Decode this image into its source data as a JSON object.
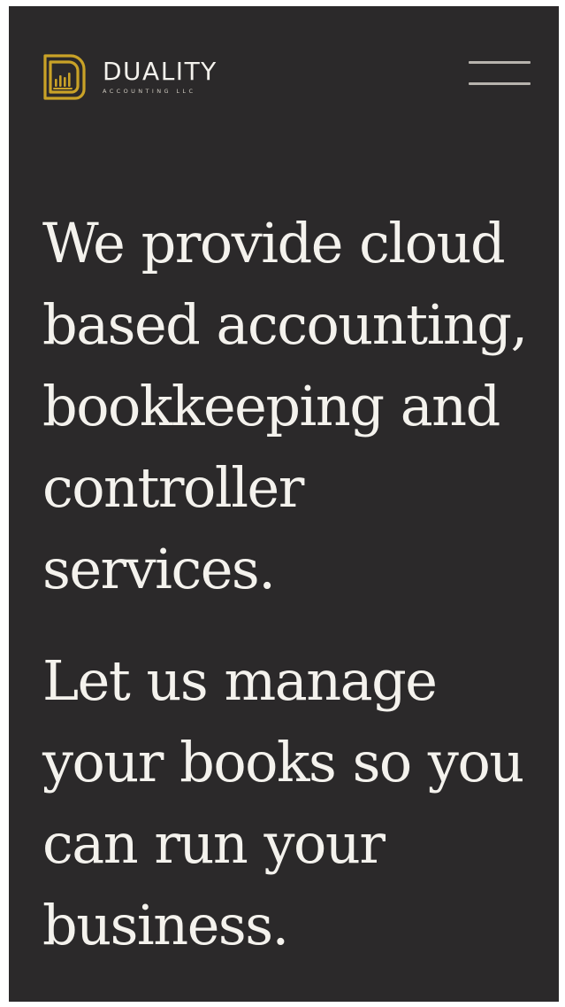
{
  "brand": {
    "name": "DUALITY",
    "subtitle": "ACCOUNTING LLC",
    "accent_color": "#c9a227"
  },
  "header": {
    "menu_icon": "hamburger-menu-icon"
  },
  "hero": {
    "line1": "We provide cloud based accounting, bookkeeping and controller services.",
    "line2": "Let us manage your books so you can run your business."
  },
  "colors": {
    "background": "#2b292a",
    "text": "#f4f2ed",
    "menu_bars": "#b7b3ad"
  }
}
